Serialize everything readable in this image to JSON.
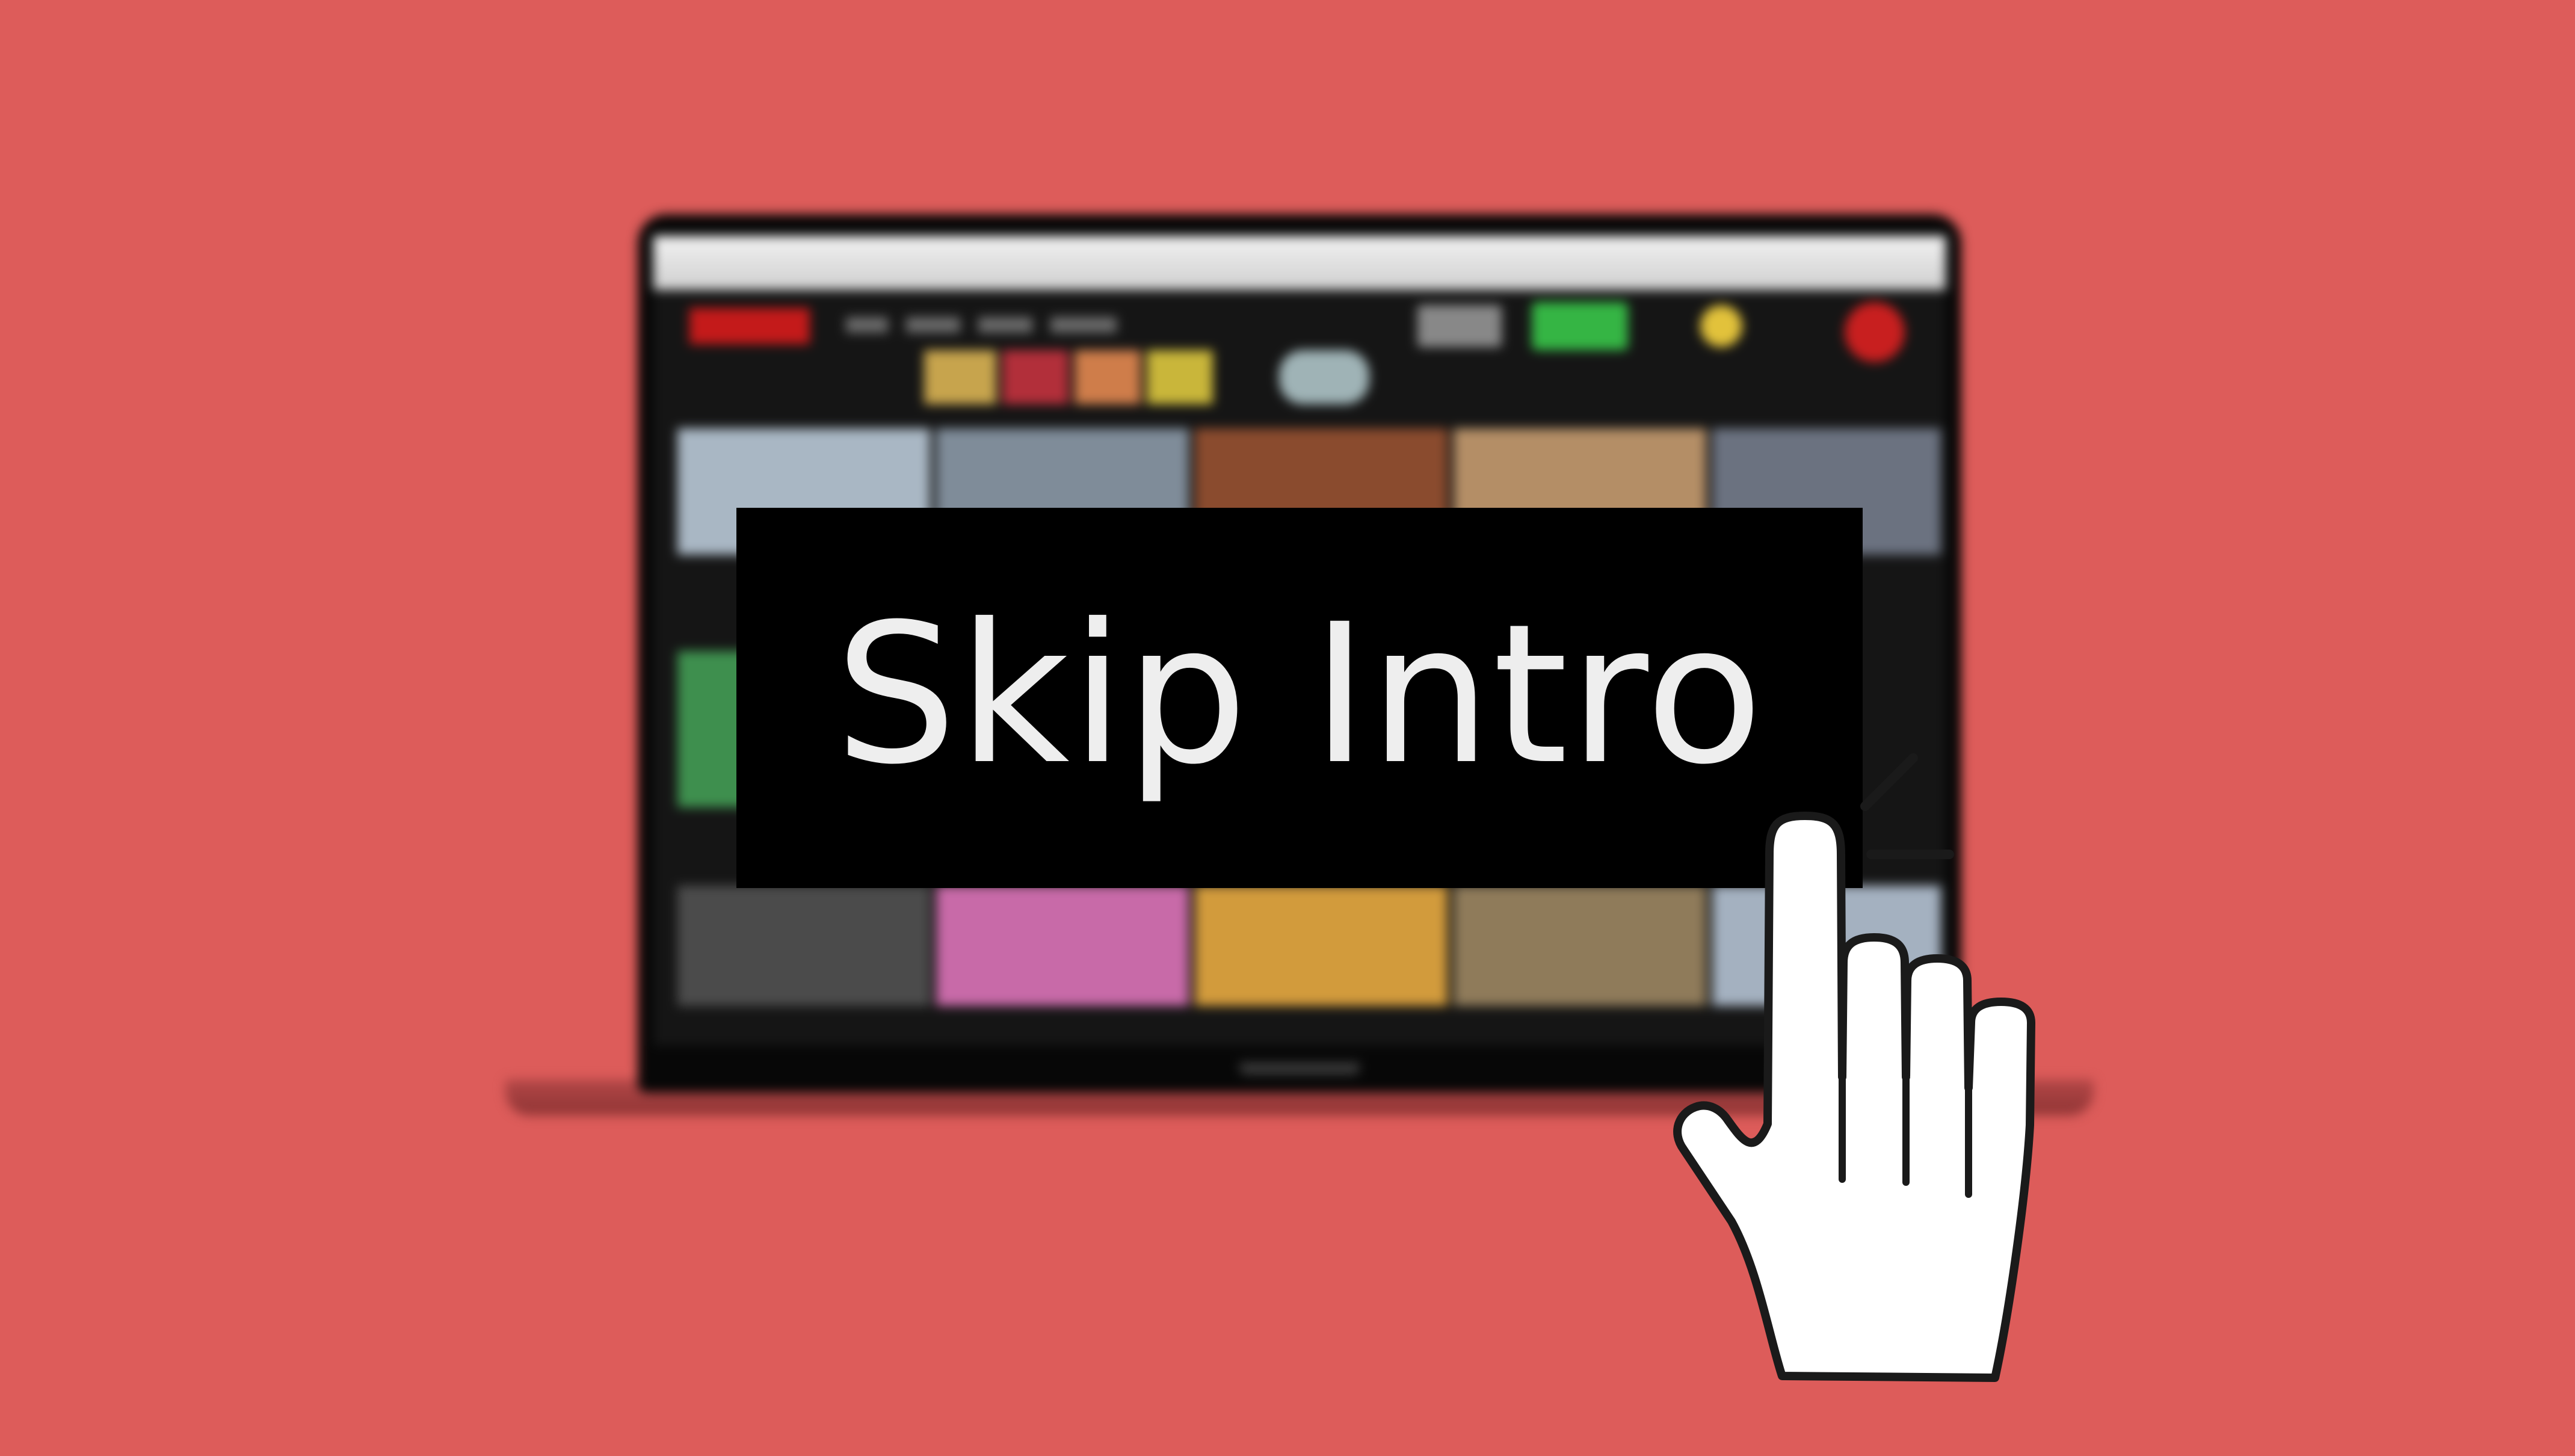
{
  "colors": {
    "background": "#DD5C5A",
    "button_background": "#000000",
    "button_text": "#EEEEEE",
    "cursor_fill": "#FFFFFF",
    "cursor_outline": "#1A1A1A"
  },
  "skip_button": {
    "label": "Skip Intro"
  },
  "cursor": {
    "icon": "pointer-hand-icon",
    "state": "clicking"
  },
  "background_scene": {
    "icon": "laptop-icon",
    "blurred": true
  }
}
